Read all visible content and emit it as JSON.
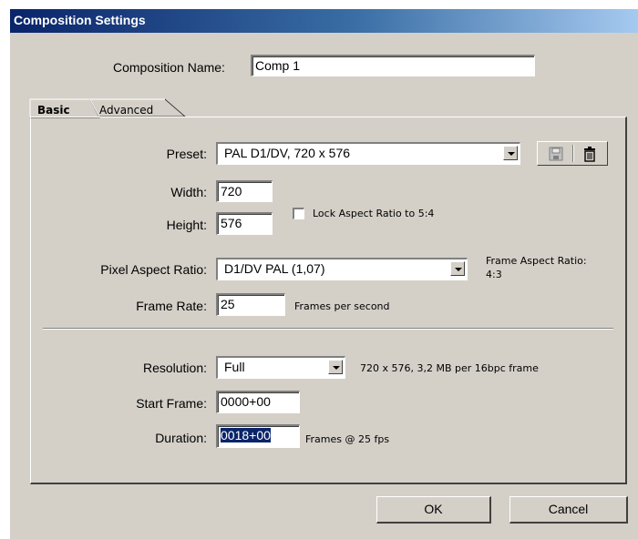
{
  "window": {
    "title": "Composition Settings"
  },
  "composition_name": {
    "label": "Composition Name:",
    "value": "Comp 1"
  },
  "tabs": [
    {
      "label": "Basic"
    },
    {
      "label": "Advanced"
    }
  ],
  "preset": {
    "label": "Preset:",
    "value": "PAL D1/DV, 720 x 576"
  },
  "width": {
    "label": "Width:",
    "value": "720"
  },
  "height": {
    "label": "Height:",
    "value": "576"
  },
  "lock_aspect": {
    "label": "Lock Aspect Ratio to 5:4",
    "checked": false
  },
  "pixel_aspect": {
    "label": "Pixel Aspect Ratio:",
    "value": "D1/DV PAL (1,07)",
    "frame_aspect_label": "Frame Aspect Ratio:",
    "frame_aspect_value": "4:3"
  },
  "frame_rate": {
    "label": "Frame Rate:",
    "value": "25",
    "unit": "Frames per second"
  },
  "resolution": {
    "label": "Resolution:",
    "value": "Full",
    "info": "720 x 576, 3,2 MB per 16bpc frame"
  },
  "start_frame": {
    "label": "Start Frame:",
    "value": "0000+00"
  },
  "duration": {
    "label": "Duration:",
    "value": "0018+00",
    "info": "Frames @ 25 fps"
  },
  "buttons": {
    "ok": "OK",
    "cancel": "Cancel"
  },
  "icons": [
    "save-preset-icon",
    "delete-preset-icon"
  ]
}
